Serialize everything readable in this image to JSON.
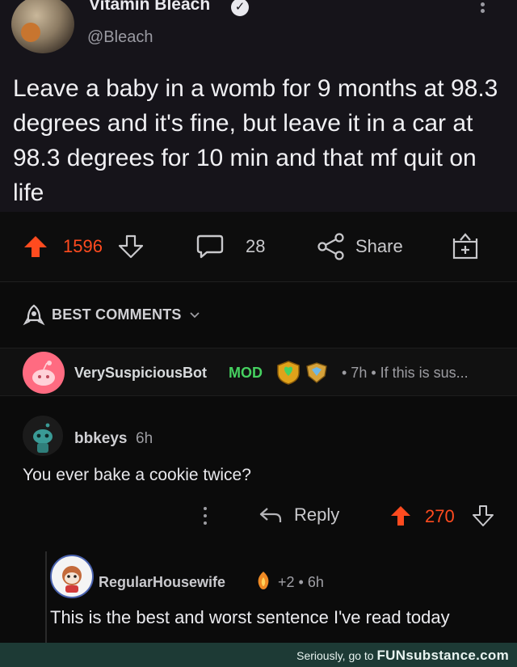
{
  "tweet": {
    "name": "Vitamin Bleach",
    "handle": "@Bleach",
    "text": "Leave a baby in a womb for 9 months at 98.3 degrees and it's fine, but leave it in a car at 98.3 degrees for 10 min and that mf quit on life"
  },
  "post_actions": {
    "score": "1596",
    "comments": "28",
    "share_label": "Share"
  },
  "sort": {
    "label": "BEST COMMENTS"
  },
  "mod_comment": {
    "user": "VerySuspiciousBot",
    "mod_tag": "MOD",
    "meta": "• 7h • If this is sus..."
  },
  "comment": {
    "user": "bbkeys",
    "time": "6h",
    "text": "You ever bake a cookie twice?",
    "reply_label": "Reply",
    "score": "270"
  },
  "reply": {
    "user": "RegularHousewife",
    "meta": "+2 • 6h",
    "text": "This is the best and worst sentence I've read today"
  },
  "footer": {
    "prefix": "Seriously, go to",
    "brand": "FUNsubstance.com"
  },
  "colors": {
    "upvote": "#ff4b1f",
    "mod_green": "#46d160",
    "background": "#0b0b0b",
    "footer_bg": "#1d3a35"
  }
}
